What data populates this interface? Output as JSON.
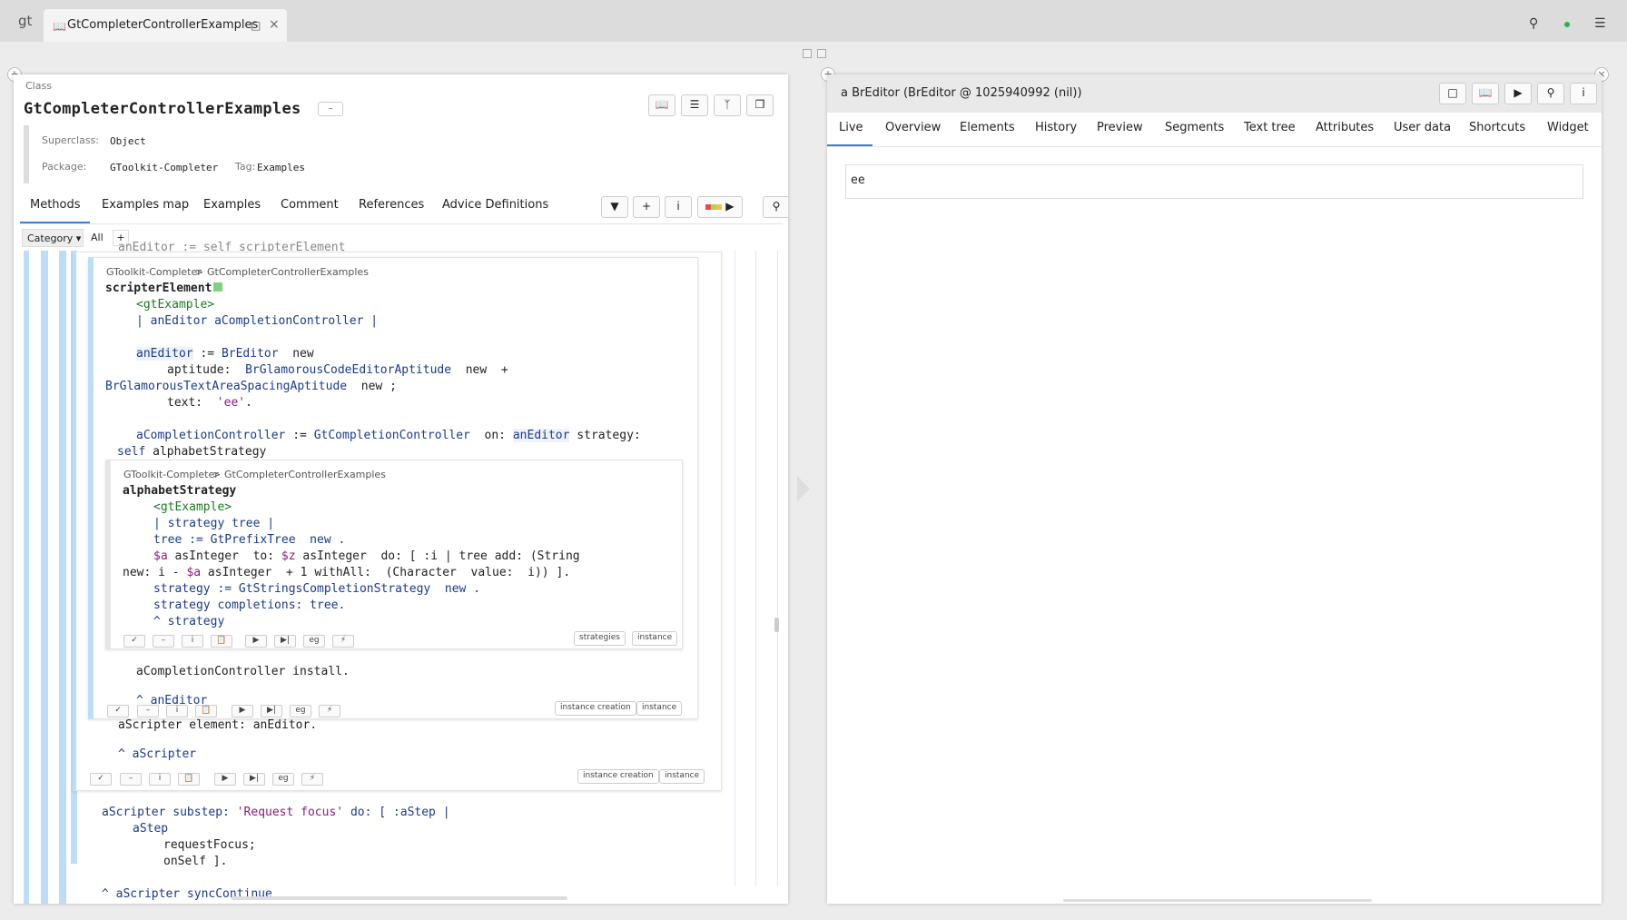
{
  "topbar": {
    "logo": "gt",
    "tab_title": "GtCompleterControllerExamples"
  },
  "left": {
    "class_label": "Class",
    "class_name": "GtCompleterControllerExamples",
    "meta": {
      "superclass_label": "Superclass:",
      "superclass_value": "Object",
      "package_label": "Package:",
      "package_value": "GToolkit-Completer",
      "tag_label": "Tag:",
      "tag_value": "Examples"
    },
    "tabs": [
      "Methods",
      "Examples map",
      "Examples",
      "Comment",
      "References",
      "Advice Definitions"
    ],
    "category": {
      "label": "Category",
      "all": "All",
      "add": "+"
    },
    "top_clip": "anEditor := self scripterElement",
    "method1": {
      "crumb_pkg": "GToolkit-Completer",
      "crumb_sep": ">",
      "crumb_cls": "GtCompleterControllerExamples",
      "selector": "scripterElement",
      "pragma": "<gtExample>",
      "temps": "| anEditor aCompletionController |",
      "l1a": "anEditor",
      "l1b": " := ",
      "l1c": "BrEditor",
      "l1d": "  new",
      "l2a": "aptitude:  ",
      "l2b": "BrGlamorousCodeEditorAptitude",
      "l2c": "  new  +",
      "l3a": "BrGlamorousTextAreaSpacingAptitude",
      "l3b": "  new ;",
      "l4a": "text:  ",
      "l4b": "'ee'",
      "l4c": ".",
      "l5a": "aCompletionController",
      "l5b": " := ",
      "l5c": "GtCompletionController",
      "l5d": "  on: ",
      "l5e": "anEditor",
      "l5f": " strategy:",
      "l6a": "self",
      "l6b": " alphabetStrategy",
      "install": "aCompletionController install.",
      "ret": "^ anEditor",
      "tags": [
        "instance creation",
        "instance"
      ]
    },
    "method2": {
      "crumb_pkg": "GToolkit-Completer",
      "crumb_sep": ">",
      "crumb_cls": "GtCompleterControllerExamples",
      "selector": "alphabetStrategy",
      "pragma": "<gtExample>",
      "temps": "| strategy tree |",
      "l1": "tree := GtPrefixTree  new .",
      "l2a": "$a",
      "l2b": " asInteger  to: ",
      "l2c": "$z",
      "l2d": " asInteger  do: [ :i | tree add: (String",
      "l3a": "new: i - ",
      "l3b": "$a",
      "l3c": " asInteger  + 1 withAll:  (Character  value:  i)) ].",
      "l4": "strategy := GtStringsCompletionStrategy  new .",
      "l5": "strategy completions: tree.",
      "l6": "^ strategy",
      "tags": [
        "strategies",
        "instance"
      ]
    },
    "outer": {
      "l1": "aScripter element: anEditor.",
      "l2": "^ aScripter",
      "tags": [
        "instance creation",
        "instance"
      ]
    },
    "bottom": {
      "l1a": "aScripter substep: ",
      "l1b": "'Request focus'",
      "l1c": " do: [ :aStep |",
      "l2": "aStep",
      "l3": "requestFocus;",
      "l4": "onSelf ].",
      "l5": "^ aScripter syncContinue"
    }
  },
  "right": {
    "title": "a BrEditor (BrEditor @ 1025940992 (nil))",
    "tabs": [
      "Live",
      "Overview",
      "Elements",
      "History",
      "Preview",
      "Segments",
      "Text tree",
      "Attributes",
      "User data",
      "Shortcuts",
      "Widget"
    ],
    "editor_text": "ee"
  }
}
